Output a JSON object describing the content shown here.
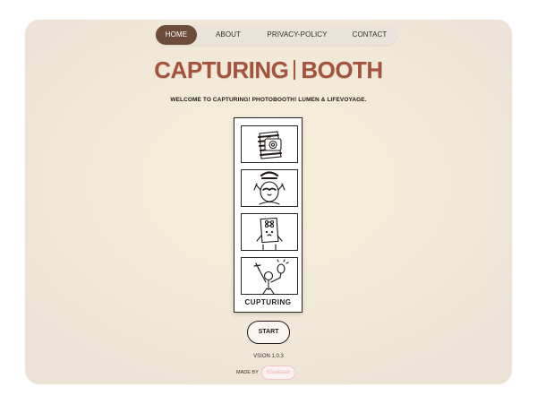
{
  "nav": {
    "items": [
      "HOME",
      "ABOUT",
      "PRIVACY-POLICY",
      "CONTACT"
    ],
    "active_index": 0
  },
  "header": {
    "title_left": "CAPTURING",
    "title_right": "BOOTH",
    "subtitle": "WELCOME TO CAPTURING! PHOTOBOOTH! LUMEN & LIFEVOYAGE."
  },
  "strip": {
    "label": "CUPTURING",
    "frames": [
      "camera-face-icon",
      "mustache-face-icon",
      "flower-paper-icon",
      "balloon-person-icon"
    ]
  },
  "start": {
    "label": "START"
  },
  "footer": {
    "version": "VSION 1.0.3",
    "made_by": "MADE BY",
    "author": "Khalilaah"
  },
  "colors": {
    "accent": "#a4533e",
    "nav_active": "#6d4c3b",
    "nav_bg": "#e9e3dc"
  }
}
